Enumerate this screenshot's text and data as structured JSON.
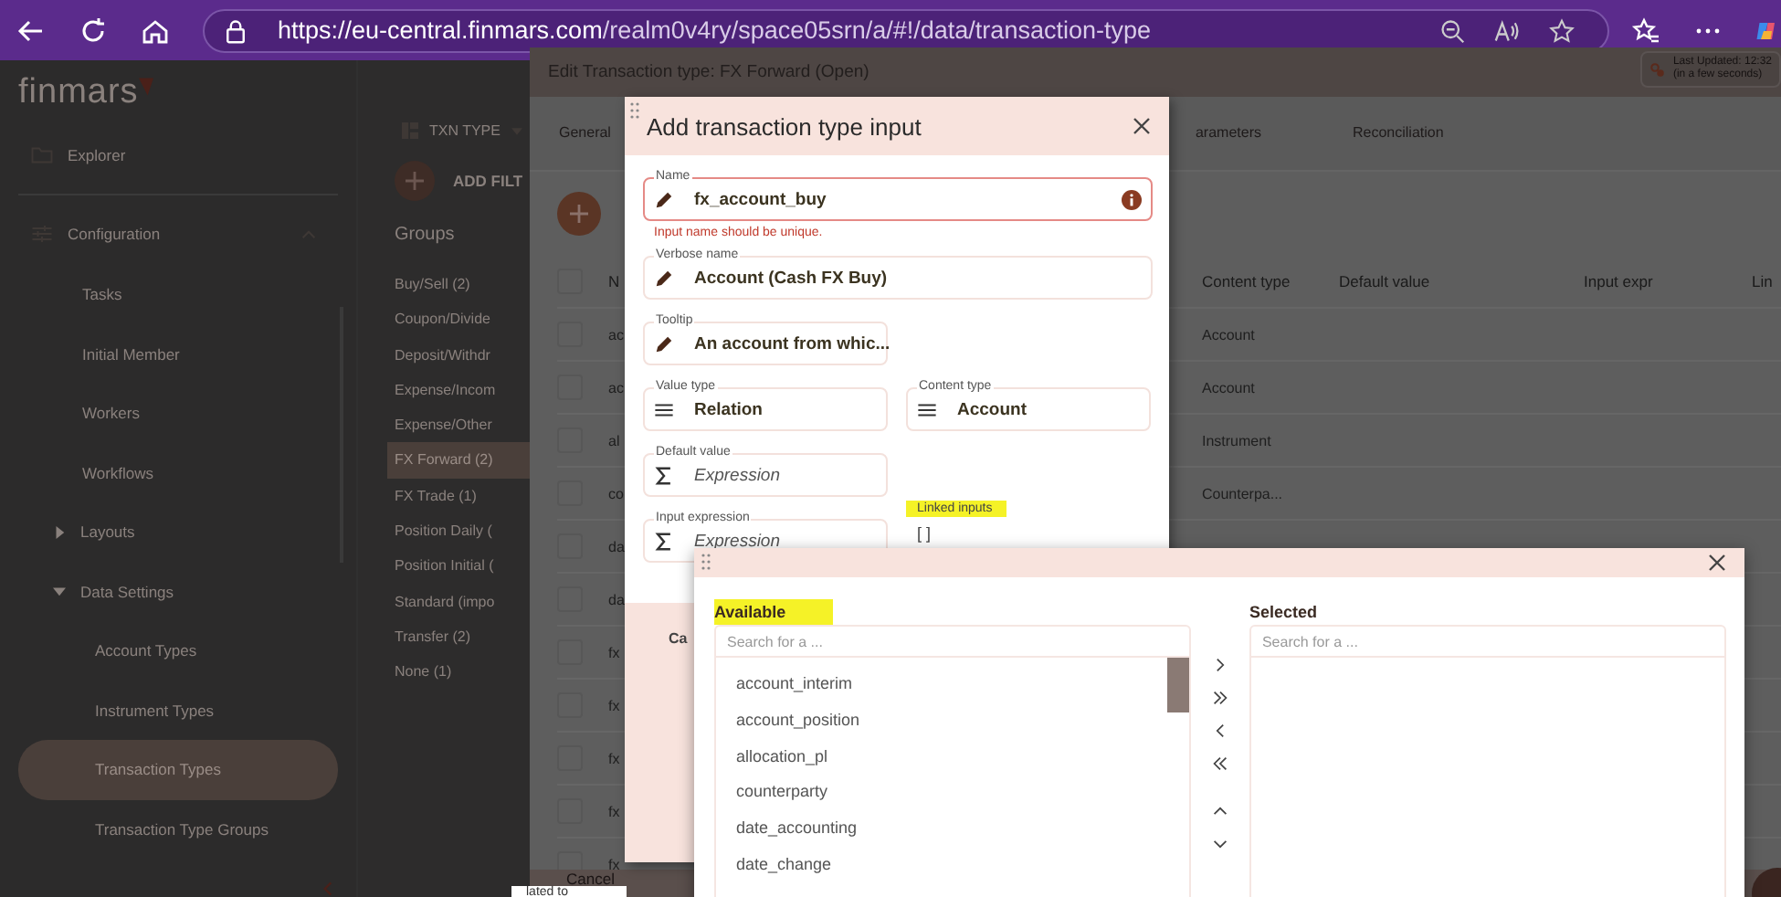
{
  "browser": {
    "url_host": "https://eu-central.finmars.com",
    "url_path": "/realm0v4ry/space05srn/a/#!/data/transaction-type"
  },
  "sidebar": {
    "logo": "finmars",
    "items": [
      {
        "label": "Explorer",
        "kind": "folder",
        "selected": false
      },
      {
        "label": "Configuration",
        "kind": "sliders",
        "selected": false,
        "expanded": true,
        "children": [
          {
            "label": "Tasks",
            "selected": false
          },
          {
            "label": "Initial Member",
            "selected": false
          },
          {
            "label": "Workers",
            "selected": false
          },
          {
            "label": "Workflows",
            "selected": false
          },
          {
            "label": "Layouts",
            "selected": false,
            "expanded": false
          },
          {
            "label": "Data Settings",
            "selected": false,
            "expanded": true,
            "children": [
              {
                "label": "Account Types",
                "selected": false
              },
              {
                "label": "Instrument Types",
                "selected": false
              },
              {
                "label": "Transaction Types",
                "selected": true
              },
              {
                "label": "Transaction Type Groups",
                "selected": false
              }
            ]
          }
        ]
      }
    ]
  },
  "groups": {
    "layout_label": "TXN TYPE",
    "add_filter": "ADD FILT",
    "heading": "Groups",
    "items": [
      {
        "label": "Buy/Sell (2)",
        "selected": false
      },
      {
        "label": "Coupon/Divide",
        "selected": false
      },
      {
        "label": "Deposit/Withdr",
        "selected": false
      },
      {
        "label": "Expense/Incom",
        "selected": false
      },
      {
        "label": "Expense/Other",
        "selected": false
      },
      {
        "label": "FX Forward (2)",
        "selected": true
      },
      {
        "label": "FX Trade (1)",
        "selected": false
      },
      {
        "label": "Position Daily (",
        "selected": false
      },
      {
        "label": "Position Initial (",
        "selected": false
      },
      {
        "label": "Standard (impo",
        "selected": false
      },
      {
        "label": "Transfer (2)",
        "selected": false
      },
      {
        "label": "None (1)",
        "selected": false
      }
    ]
  },
  "edit_dialog": {
    "title": "Edit Transaction type: FX Forward (Open)",
    "update_badge": {
      "line_1": "Last Updated: 12:32",
      "line_2": "(in a few seconds)"
    },
    "tabs": [
      {
        "label": "General",
        "selected": false
      },
      {
        "label": "arameters",
        "selected": false
      },
      {
        "label": "Reconciliation",
        "selected": false
      }
    ],
    "table": {
      "header_checked": false,
      "columns": [
        "N",
        "Content type",
        "Default value",
        "Input expr",
        "Lin"
      ],
      "rows": [
        {
          "name": "ac",
          "content_type": "Account",
          "checked": false
        },
        {
          "name": "ac",
          "content_type": "Account",
          "checked": false
        },
        {
          "name": "al",
          "content_type": "Instrument",
          "checked": false
        },
        {
          "name": "co",
          "content_type": "Counterpa...",
          "checked": false
        },
        {
          "name": "da",
          "checked": false
        },
        {
          "name": "da",
          "checked": false
        },
        {
          "name": "fx",
          "checked": false
        },
        {
          "name": "fx",
          "checked": false
        },
        {
          "name": "fx",
          "checked": false
        },
        {
          "name": "fx",
          "checked": false
        },
        {
          "name": "fx",
          "checked": false
        }
      ]
    },
    "cancel": "Cancel"
  },
  "input_dialog": {
    "title": "Add transaction type input",
    "name_field": {
      "label": "Name",
      "value": "fx_account_buy",
      "error": "Input name should be unique.",
      "kind": "text"
    },
    "verbose_field": {
      "label": "Verbose name",
      "value": "Account (Cash FX Buy)",
      "kind": "text"
    },
    "rows": [
      [
        {
          "label": "Tooltip",
          "value": "An account from whic...",
          "kind": "text"
        }
      ],
      [
        {
          "label": "Value type",
          "value": "Relation",
          "kind": "select"
        },
        {
          "label": "Content type",
          "value": "Account",
          "kind": "select"
        }
      ],
      [
        {
          "label": "Default value",
          "placeholder": "Expression",
          "kind": "expression"
        }
      ],
      [
        {
          "label": "Input expression",
          "placeholder": "Expression",
          "kind": "expression"
        },
        {
          "label": "Linked inputs",
          "value": "[ ]",
          "kind": "linked",
          "highlighted": true
        }
      ]
    ],
    "cancel": "Ca"
  },
  "picker_dialog": {
    "available": {
      "heading": "Available",
      "highlighted": true,
      "placeholder": "Search for a ...",
      "items": [
        "account_interim",
        "account_position",
        "allocation_pl",
        "counterparty",
        "date_accounting",
        "date_change"
      ]
    },
    "selected": {
      "heading": "Selected",
      "highlighted": false,
      "placeholder": "Search for a ..."
    }
  },
  "tooltip_fragment": "lated to"
}
